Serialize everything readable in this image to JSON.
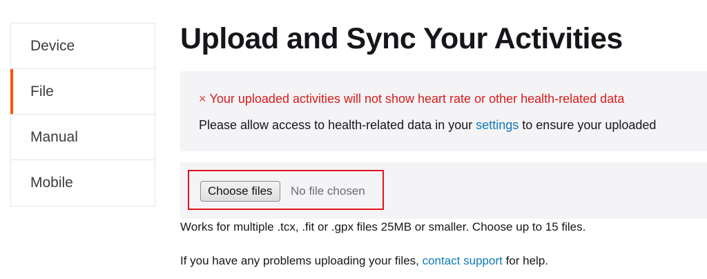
{
  "sidebar": {
    "items": [
      {
        "label": "Device",
        "active": false
      },
      {
        "label": "File",
        "active": true
      },
      {
        "label": "Manual",
        "active": false
      },
      {
        "label": "Mobile",
        "active": false
      }
    ]
  },
  "page": {
    "title": "Upload and Sync Your Activities"
  },
  "alert": {
    "icon": "close-icon",
    "icon_glyph": "×",
    "heading": "Your uploaded activities will not show heart rate or other health-related data",
    "body_before": "Please allow access to health-related data in your ",
    "body_link": "settings",
    "body_after": " to ensure your uploaded"
  },
  "upload": {
    "button_label": "Choose files",
    "status": "No file chosen"
  },
  "info": {
    "formats": "Works for multiple .tcx, .fit or .gpx files 25MB or smaller. Choose up to 15 files.",
    "help_before": "If you have any problems uploading your files, ",
    "help_link": "contact support",
    "help_after": " for help."
  },
  "colors": {
    "accent": "#fc5200",
    "alert_text": "#d91a1a",
    "link": "#0d7ab7",
    "highlight_box": "#e0141c",
    "panel_bg": "#f4f4f6"
  }
}
